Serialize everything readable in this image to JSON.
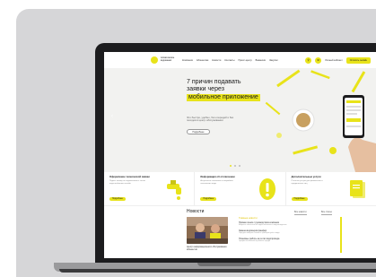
{
  "site": {
    "logo_text": "Алматинские водоканал",
    "nav": [
      "Компания",
      "Абонентам",
      "Новости",
      "Контакты",
      "Пресс-центр",
      "Вакансии",
      "Закупки"
    ],
    "cabinet_label": "Личный кабинет",
    "cta_label": "Оплатить онлайн"
  },
  "hero": {
    "title_line1": "7 причин подавать",
    "title_line2": "заявки через",
    "title_highlight": "мобильное приложение",
    "subtitle": "Это быстро, удобно, без очередей и без походов в центр обслуживания",
    "button_label": "Подробнее",
    "prev_glyph": "‹"
  },
  "services": [
    {
      "title": "Оформление технической заявки",
      "desc": "Подать заявку на подключение к сетям водоснабжения онлайн",
      "button": "Подробнее"
    },
    {
      "title": "Информация об отключении",
      "desc": "Актуальные плановые и аварийные отключения воды",
      "button": "Подробнее"
    },
    {
      "title": "Дополнительные услуги",
      "desc": "Платные услуги для физических и юридических лиц",
      "button": "Подробнее"
    }
  ],
  "news": {
    "title": "Новости",
    "filter1": "Все новости",
    "filter2": "Все статьи",
    "tag": "Главные новости",
    "photo_caption": "Центр информационного обслуживания абонентов",
    "items": [
      {
        "title": "Прямая линия с руководством компании",
        "desc": "Вопросы абонентов по водоснабжению и водоотведению"
      },
      {
        "title": "Замена водомеров фанфир",
        "desc": "Порядок поверки и замены приборов учёта воды"
      },
      {
        "title": "Плановые работы на сетях водопровода",
        "desc": "График отключений в районах города"
      }
    ]
  },
  "colors": {
    "accent": "#e8e31a",
    "hero_bg": "#f2f2f0",
    "stage": "#d6d6d8"
  }
}
